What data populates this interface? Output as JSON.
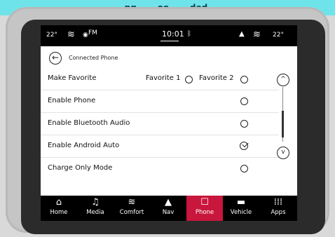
{
  "caption": "...ng… ...oo… ...ded ...",
  "status_bar": {
    "temp_left": "22°",
    "radio_band": "FM",
    "time": "10:01",
    "temp_right": "22°"
  },
  "header": {
    "title": "Connected Phone"
  },
  "settings": [
    {
      "label": "Make Favorite",
      "type": "favorite",
      "options": [
        "Favorite 1",
        "Favorite 2"
      ]
    },
    {
      "label": "Enable Phone",
      "type": "radio",
      "checked": false
    },
    {
      "label": "Enable Bluetooth Audio",
      "type": "radio",
      "checked": false
    },
    {
      "label": "Enable Android Auto",
      "type": "check",
      "checked": true
    },
    {
      "label": "Charge Only Mode",
      "type": "radio",
      "checked": false
    }
  ],
  "nav": {
    "items": [
      {
        "label": "Home",
        "icon": "home-icon",
        "glyph": "⌂"
      },
      {
        "label": "Media",
        "icon": "music-note-icon",
        "glyph": "♫"
      },
      {
        "label": "Comfort",
        "icon": "seat-heat-icon",
        "glyph": "≋"
      },
      {
        "label": "Nav",
        "icon": "navigation-arrow-icon",
        "glyph": "▲"
      },
      {
        "label": "Phone",
        "icon": "phone-icon",
        "glyph": "☐"
      },
      {
        "label": "Vehicle",
        "icon": "car-icon",
        "glyph": "▬"
      },
      {
        "label": "Apps",
        "icon": "apps-grid-icon",
        "glyph": "⁞⁞⁞"
      }
    ],
    "active": "Phone"
  },
  "colors": {
    "active_tab": "#c8163c",
    "caption_bg": "#6fe3ea"
  }
}
